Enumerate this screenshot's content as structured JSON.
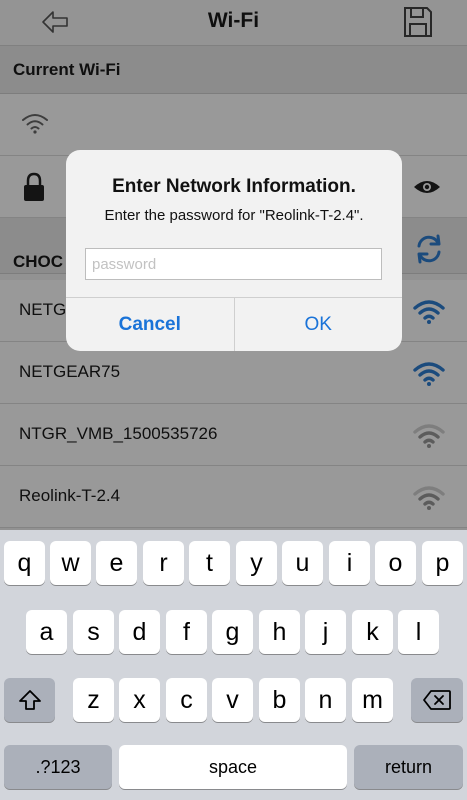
{
  "navbar": {
    "title": "Wi-Fi",
    "back_icon": "back-arrow-icon",
    "save_icon": "save-floppy-icon"
  },
  "current_wifi": {
    "header": "Current Wi-Fi"
  },
  "choose": {
    "header_visible": "CHOC"
  },
  "networks": [
    {
      "name": "NETG",
      "signal": "strong"
    },
    {
      "name": "NETGEAR75",
      "signal": "strong"
    },
    {
      "name": "NTGR_VMB_1500535726",
      "signal": "weak"
    },
    {
      "name": "Reolink-T-2.4",
      "signal": "weak"
    }
  ],
  "alert": {
    "title": "Enter Network Information.",
    "message": "Enter the password for \"Reolink-T-2.4\".",
    "input_value": "",
    "input_placeholder": "password",
    "cancel_label": "Cancel",
    "ok_label": "OK"
  },
  "colors": {
    "accent": "#1a73d8",
    "wifi_strong": "#2e7dd1",
    "wifi_weak": "#9a9a9a"
  },
  "keyboard": {
    "row1": [
      "q",
      "w",
      "e",
      "r",
      "t",
      "y",
      "u",
      "i",
      "o",
      "p"
    ],
    "row2": [
      "a",
      "s",
      "d",
      "f",
      "g",
      "h",
      "j",
      "k",
      "l"
    ],
    "row3": [
      "z",
      "x",
      "c",
      "v",
      "b",
      "n",
      "m"
    ],
    "numbers_label": ".?123",
    "space_label": "space",
    "return_label": "return",
    "shift_icon": "shift-icon",
    "delete_icon": "delete-icon"
  }
}
